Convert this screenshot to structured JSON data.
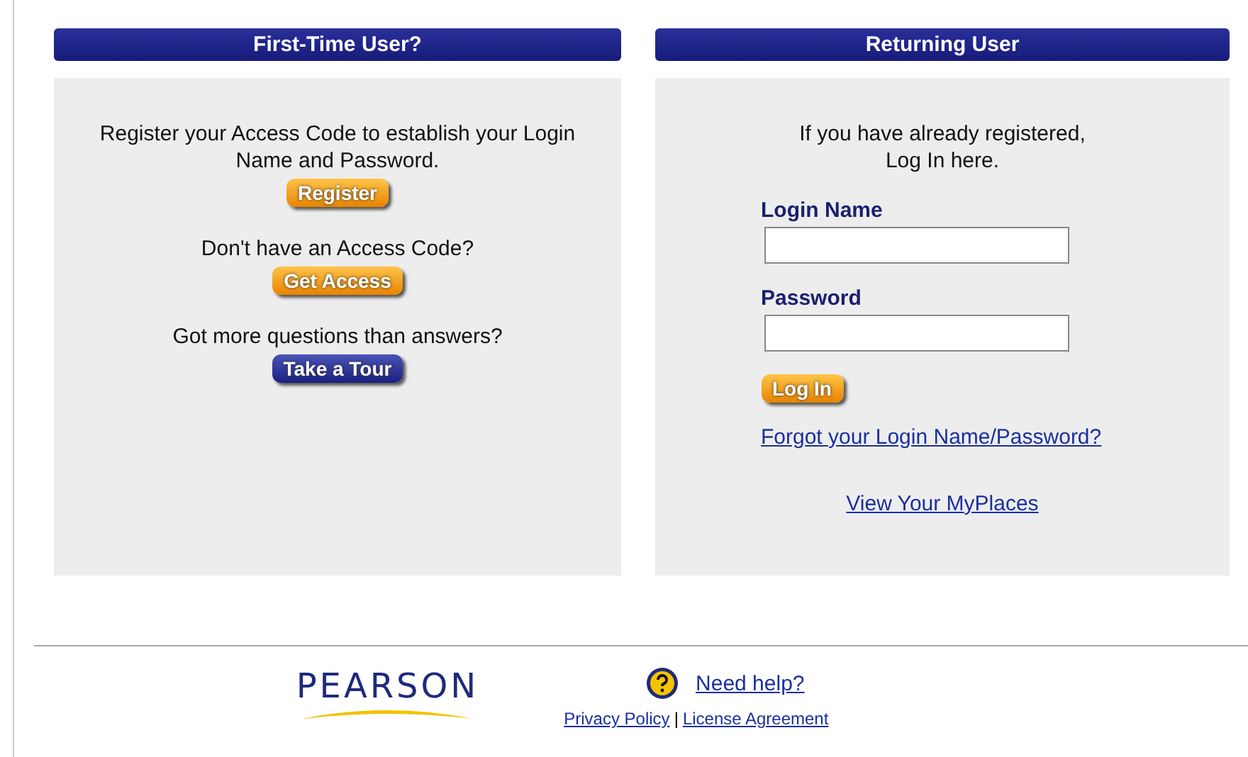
{
  "first_time": {
    "title": "First-Time User?",
    "items": [
      {
        "text": "Register your Access Code to establish your Login Name and Password.",
        "button": "Register",
        "kind": "orange"
      },
      {
        "text": "Don't have an Access Code?",
        "button": "Get Access",
        "kind": "orange"
      },
      {
        "text": "Got more questions than answers?",
        "button": "Take a Tour",
        "kind": "blue"
      }
    ]
  },
  "returning": {
    "title": "Returning User",
    "intro": [
      "If you have already registered,",
      "Log In here."
    ],
    "fields": [
      {
        "label": "Login Name"
      },
      {
        "label": "Password"
      }
    ],
    "button": "Log In",
    "forgot_link": "Forgot your Login Name/Password?",
    "myplaces_link": "View Your MyPlaces"
  },
  "footer": {
    "logo": "PEARSON",
    "help_link": "Need help?",
    "links": [
      "Privacy Policy",
      "License Agreement"
    ],
    "separator": "|"
  }
}
